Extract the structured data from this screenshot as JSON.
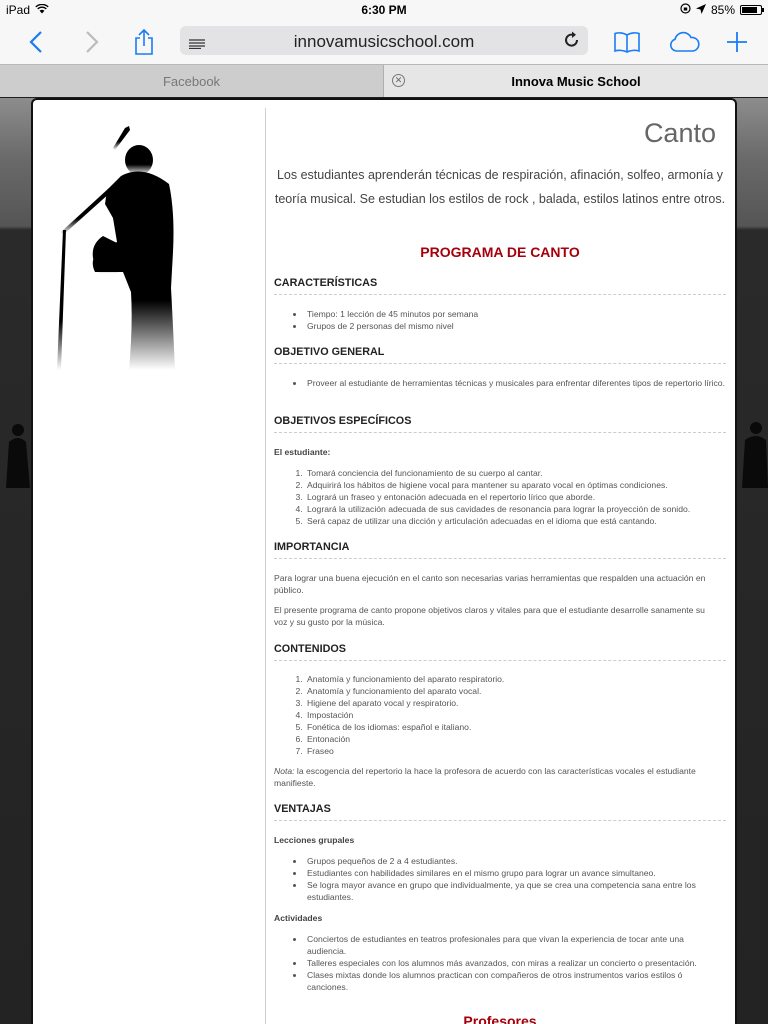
{
  "status": {
    "device": "iPad",
    "time": "6:30 PM",
    "battery": "85%",
    "battery_level": 0.85
  },
  "browser": {
    "url": "innovamusicschool.com",
    "tabs": [
      {
        "label": "Facebook",
        "active": false
      },
      {
        "label": "Innova Music School",
        "active": true
      }
    ],
    "accent": "#1a7cf5"
  },
  "page": {
    "title": "Canto",
    "intro": "Los estudiantes aprenderán técnicas de respiración, afinación, solfeo, armonía y teoría musical. Se estudian los estilos de rock , balada, estilos latinos entre otros.",
    "program_title": "PROGRAMA DE CANTO",
    "title_color": "#a5000b",
    "sections": {
      "caracteristicas": {
        "heading": "CARACTERÍSTICAS",
        "items": [
          "Tiempo: 1 lección de 45 minutos por semana",
          "Grupos de 2 personas del mismo nivel"
        ]
      },
      "objetivo_general": {
        "heading": "OBJETIVO GENERAL",
        "items": [
          "Proveer al estudiante de herramientas técnicas y musicales para enfrentar diferentes tipos de repertorio lírico."
        ]
      },
      "objetivos_especificos": {
        "heading": "OBJETIVOS ESPECÍFICOS",
        "subheading": "El estudiante:",
        "items": [
          "Tomará conciencia del funcionamiento de su cuerpo al cantar.",
          "Adquirirá los hábitos de higiene vocal para mantener su aparato vocal en óptimas condiciones.",
          "Logrará un fraseo y entonación adecuada en el repertorio lírico que aborde.",
          "Logrará la utilización adecuada de sus cavidades de resonancia para lograr la proyección de sonido.",
          "Será capaz de utilizar una dicción y articulación adecuadas en el idioma que está cantando."
        ]
      },
      "importancia": {
        "heading": "IMPORTANCIA",
        "paragraphs": [
          "Para lograr una buena ejecución en el canto son necesarias varias herramientas que respalden una actuación en público.",
          "El presente programa de canto propone objetivos claros y vitales para que el estudiante desarrolle sanamente su voz y su gusto por la música."
        ]
      },
      "contenidos": {
        "heading": "CONTENIDOS",
        "items": [
          "Anatomía y funcionamiento del aparato respiratorio.",
          "Anatomía y funcionamiento del aparato vocal.",
          "Higiene del aparato vocal y respiratorio.",
          "Impostación",
          "Fonética de los idiomas: español e italiano.",
          "Entonación",
          "Fraseo"
        ],
        "note_label": "Nota:",
        "note_text": " la escogencia del  repertorio la hace la profesora de acuerdo con las características vocales el estudiante manifieste."
      },
      "ventajas": {
        "heading": "VENTAJAS",
        "sub1": "Lecciones grupales",
        "items1": [
          "Grupos pequeños de 2 a 4 estudiantes.",
          "Estudiantes con habilidades similares en el mismo grupo para lograr un avance simultaneo.",
          "Se logra mayor avance en grupo que individualmente, ya que se crea una competencia sana entre los estudiantes."
        ],
        "sub2": "Actividades",
        "items2": [
          "Conciertos de estudiantes en teatros profesionales para que vivan la experiencia de tocar ante una audiencia.",
          "Talleres especiales con los alumnos más avanzados, con miras a realizar un concierto o presentación.",
          "Clases mixtas donde los alumnos practican con compañeros de otros instrumentos varios estilos ó canciones."
        ]
      }
    },
    "profesores_title": "Profesores"
  }
}
